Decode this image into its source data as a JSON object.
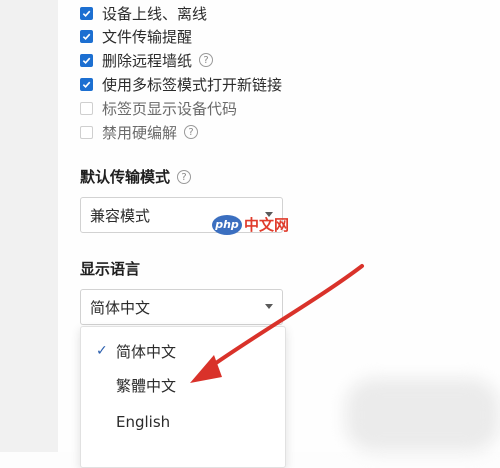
{
  "checkboxes": [
    {
      "label": "设备上线、离线",
      "checked": true,
      "help": false
    },
    {
      "label": "文件传输提醒",
      "checked": true,
      "help": false
    },
    {
      "label": "删除远程墙纸",
      "checked": true,
      "help": true
    },
    {
      "label": "使用多标签模式打开新链接",
      "checked": true,
      "help": false
    },
    {
      "label": "标签页显示设备代码",
      "checked": false,
      "help": false
    },
    {
      "label": "禁用硬编解",
      "checked": false,
      "help": true
    }
  ],
  "help_glyph": "?",
  "transfer": {
    "title": "默认传输模式",
    "value": "兼容模式"
  },
  "language": {
    "title": "显示语言",
    "value": "简体中文",
    "options": [
      {
        "label": "简体中文",
        "selected": true
      },
      {
        "label": "繁體中文",
        "selected": false
      },
      {
        "label": "English",
        "selected": false
      }
    ],
    "check_glyph": "✓"
  },
  "watermark": {
    "badge": "php",
    "text": "中文网"
  },
  "colors": {
    "accent": "#1c6fd1",
    "arrow": "#d9322a"
  }
}
